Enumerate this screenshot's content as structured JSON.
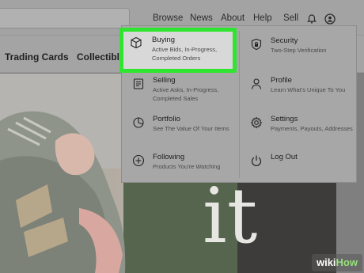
{
  "header": {
    "nav_items": [
      {
        "label": "Browse"
      },
      {
        "label": "News"
      },
      {
        "label": "About"
      },
      {
        "label": "Help"
      },
      {
        "label": "Sell"
      }
    ],
    "icons": [
      "bell-icon",
      "user-icon"
    ]
  },
  "categories": [
    {
      "label": "Trading Cards"
    },
    {
      "label": "Collectible"
    }
  ],
  "hero": {
    "text": "it"
  },
  "dropdown": {
    "left_items": [
      {
        "title": "Buying",
        "desc": "Active Bids, In-Progress, Completed Orders",
        "icon": "box-icon"
      },
      {
        "title": "Selling",
        "desc": "Active Asks, In-Progress, Completed Sales",
        "icon": "receipt-icon"
      },
      {
        "title": "Portfolio",
        "desc": "See The Value Of Your Items",
        "icon": "chart-icon"
      },
      {
        "title": "Following",
        "desc": "Products You're Watching",
        "icon": "plus-circle-icon"
      }
    ],
    "right_items": [
      {
        "title": "Security",
        "desc": "Two-Step Verification",
        "icon": "lock-icon"
      },
      {
        "title": "Profile",
        "desc": "Learn What's Unique To You",
        "icon": "person-icon"
      },
      {
        "title": "Settings",
        "desc": "Payments, Payouts, Addresses",
        "icon": "gear-icon"
      },
      {
        "title": "Log Out",
        "desc": "",
        "icon": "power-icon"
      }
    ]
  },
  "watermark": {
    "part1": "wiki",
    "part2": "How"
  },
  "colors": {
    "highlight": "#2fe52f",
    "accent": "#96e07a"
  }
}
